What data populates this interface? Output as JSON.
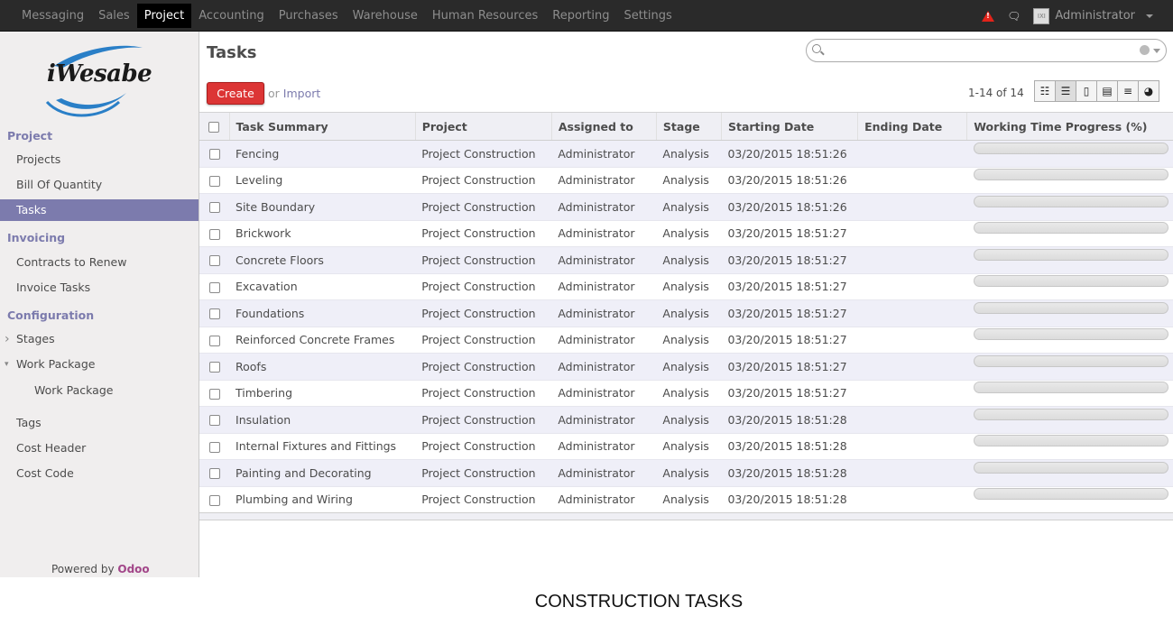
{
  "topmenu": [
    "Messaging",
    "Sales",
    "Project",
    "Accounting",
    "Purchases",
    "Warehouse",
    "Human Resources",
    "Reporting",
    "Settings"
  ],
  "topmenu_active": "Project",
  "user": {
    "name": "Administrator",
    "avatar_text": "IXI"
  },
  "logo": {
    "text": "iWesabe"
  },
  "sidebar": {
    "sections": [
      {
        "title": "Project",
        "items": [
          {
            "label": "Projects"
          },
          {
            "label": "Bill Of Quantity"
          },
          {
            "label": "Tasks",
            "active": true
          }
        ]
      },
      {
        "title": "Invoicing",
        "items": [
          {
            "label": "Contracts to Renew"
          },
          {
            "label": "Invoice Tasks"
          }
        ]
      },
      {
        "title": "Configuration",
        "items": [
          {
            "label": "Stages",
            "collapsed": true
          },
          {
            "label": "Work Package",
            "expanded": true
          },
          {
            "label": "Work Package",
            "sub": true
          },
          {
            "label": "Tags"
          },
          {
            "label": "Cost Header"
          },
          {
            "label": "Cost Code"
          }
        ]
      }
    ],
    "powered_by": "Powered by",
    "powered_brand": "Odoo"
  },
  "header": {
    "title": "Tasks",
    "create_label": "Create",
    "or_label": "or",
    "import_label": "Import",
    "pager": "1-14 of 14"
  },
  "table": {
    "columns": [
      "Task Summary",
      "Project",
      "Assigned to",
      "Stage",
      "Starting Date",
      "Ending Date",
      "Working Time Progress (%)"
    ],
    "rows": [
      [
        "Fencing",
        "Project Construction",
        "Administrator",
        "Analysis",
        "03/20/2015 18:51:26",
        ""
      ],
      [
        "Leveling",
        "Project Construction",
        "Administrator",
        "Analysis",
        "03/20/2015 18:51:26",
        ""
      ],
      [
        "Site Boundary",
        "Project Construction",
        "Administrator",
        "Analysis",
        "03/20/2015 18:51:26",
        ""
      ],
      [
        "Brickwork",
        "Project Construction",
        "Administrator",
        "Analysis",
        "03/20/2015 18:51:27",
        ""
      ],
      [
        "Concrete Floors",
        "Project Construction",
        "Administrator",
        "Analysis",
        "03/20/2015 18:51:27",
        ""
      ],
      [
        "Excavation",
        "Project Construction",
        "Administrator",
        "Analysis",
        "03/20/2015 18:51:27",
        ""
      ],
      [
        "Foundations",
        "Project Construction",
        "Administrator",
        "Analysis",
        "03/20/2015 18:51:27",
        ""
      ],
      [
        "Reinforced Concrete Frames",
        "Project Construction",
        "Administrator",
        "Analysis",
        "03/20/2015 18:51:27",
        ""
      ],
      [
        "Roofs",
        "Project Construction",
        "Administrator",
        "Analysis",
        "03/20/2015 18:51:27",
        ""
      ],
      [
        "Timbering",
        "Project Construction",
        "Administrator",
        "Analysis",
        "03/20/2015 18:51:27",
        ""
      ],
      [
        "Insulation",
        "Project Construction",
        "Administrator",
        "Analysis",
        "03/20/2015 18:51:28",
        ""
      ],
      [
        "Internal Fixtures and Fittings",
        "Project Construction",
        "Administrator",
        "Analysis",
        "03/20/2015 18:51:28",
        ""
      ],
      [
        "Painting and Decorating",
        "Project Construction",
        "Administrator",
        "Analysis",
        "03/20/2015 18:51:28",
        ""
      ],
      [
        "Plumbing and Wiring",
        "Project Construction",
        "Administrator",
        "Analysis",
        "03/20/2015 18:51:28",
        ""
      ]
    ],
    "progress": [
      0,
      0,
      0,
      0,
      0,
      0,
      0,
      0,
      0,
      0,
      0,
      0,
      0,
      0
    ]
  },
  "caption": "CONSTRUCTION TASKS",
  "colors": {
    "accent": "#7c7bad",
    "create": "#dc3535",
    "topbar": "#2a2a2a",
    "brand": "#a24689"
  }
}
